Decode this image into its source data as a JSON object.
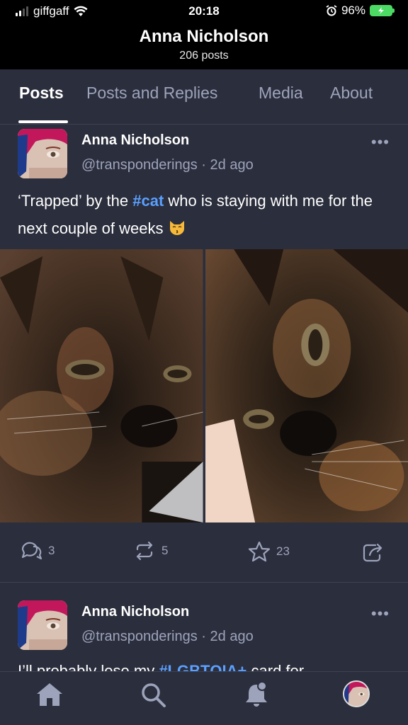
{
  "status_bar": {
    "carrier": "giffgaff",
    "time": "20:18",
    "battery": "96%",
    "icons": [
      "signal-icon",
      "wifi-icon",
      "alarm-icon",
      "battery-charging-icon"
    ]
  },
  "profile": {
    "name": "Anna Nicholson",
    "posts_count": "206 posts"
  },
  "tabs": [
    {
      "label": "Posts",
      "active": true
    },
    {
      "label": "Posts and Replies",
      "active": false
    },
    {
      "label": "Media",
      "active": false
    },
    {
      "label": "About",
      "active": false
    }
  ],
  "posts": [
    {
      "author": "Anna Nicholson",
      "handle": "@transponderings",
      "age": "2d ago",
      "more": "•••",
      "text_before": "‘Trapped’ by the ",
      "hashtag": "#cat",
      "text_after": " who is staying with me for the next couple of weeks",
      "emoji": "kissing-cat-emoji",
      "images": [
        "tortoiseshell-cat-photo-1",
        "tortoiseshell-cat-photo-2"
      ],
      "replies": "3",
      "boosts": "5",
      "favourites": "23"
    },
    {
      "author": "Anna Nicholson",
      "handle": "@transponderings",
      "age": "2d ago",
      "more": "•••",
      "text_before": "I’ll probably lose my ",
      "hashtag": "#LGBTQIA+",
      "text_after": " card for"
    }
  ],
  "bottom_nav": [
    "home-icon",
    "search-icon",
    "notifications-icon",
    "profile-avatar"
  ],
  "colors": {
    "background": "#2b2e3c",
    "accent_link": "#5aa0ff",
    "muted_text": "#9da3bb",
    "battery_green": "#4cd964"
  }
}
